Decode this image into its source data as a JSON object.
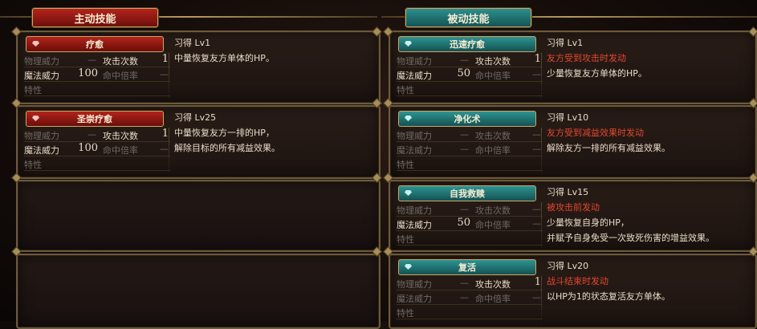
{
  "tabs": {
    "active": "主动技能",
    "passive": "被动技能"
  },
  "labels": {
    "phys": "物理威力",
    "hits": "攻击次数",
    "magic": "魔法威力",
    "accuracy": "命中倍率",
    "trait": "特性",
    "dash": "—"
  },
  "active_skills": [
    {
      "name": "疗愈",
      "hits": "1",
      "magic": "100",
      "level": "习得 Lv1",
      "desc1": "中量恢复友方单体的HP。",
      "desc2": ""
    },
    {
      "name": "圣崇疗愈",
      "hits": "1",
      "magic": "100",
      "level": "习得 Lv25",
      "desc1": "中量恢复友方一排的HP，",
      "desc2": "解除目标的所有减益效果。"
    }
  ],
  "passive_skills": [
    {
      "name": "迅速疗愈",
      "hits": "1",
      "magic": "50",
      "level": "习得 Lv1",
      "trigger": "友方受到攻击时发动",
      "desc1": "少量恢复友方单体的HP。",
      "desc2": ""
    },
    {
      "name": "净化术",
      "hits": "",
      "magic": "",
      "level": "习得 Lv10",
      "trigger": "友方受到减益效果时发动",
      "desc1": "解除友方一排的所有减益效果。",
      "desc2": ""
    },
    {
      "name": "自我救赎",
      "hits": "",
      "magic": "50",
      "level": "习得 Lv15",
      "trigger": "被攻击前发动",
      "desc1": "少量恢复自身的HP，",
      "desc2": "并赋予自身免受一次致死伤害的增益效果。"
    },
    {
      "name": "复活",
      "hits": "1",
      "magic": "",
      "level": "习得 Lv20",
      "trigger": "战斗结束时发动",
      "desc1": "以HP为1的状态复活友方单体。",
      "desc2": ""
    }
  ]
}
